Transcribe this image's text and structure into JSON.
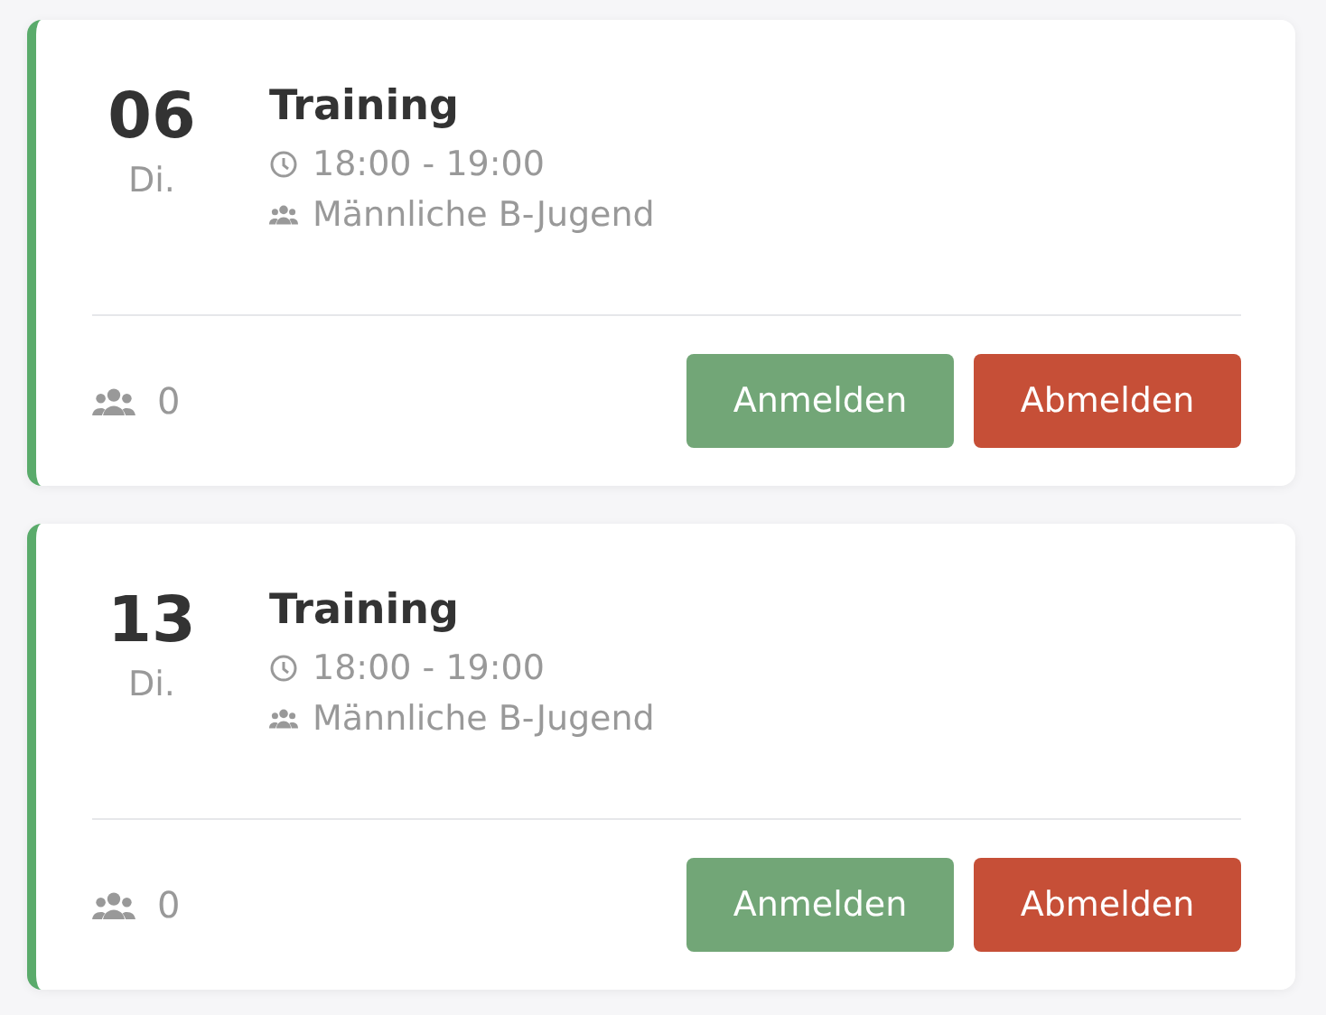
{
  "events": [
    {
      "day": "06",
      "weekday": "Di.",
      "title": "Training",
      "time": "18:00 - 19:00",
      "team": "Männliche B-Jugend",
      "attendees": "0",
      "buttons": [
        {
          "label": "Anmelden",
          "kind": "accept"
        },
        {
          "label": "Abmelden",
          "kind": "decline"
        }
      ]
    },
    {
      "day": "13",
      "weekday": "Di.",
      "title": "Training",
      "time": "18:00 - 19:00",
      "team": "Männliche B-Jugend",
      "attendees": "0",
      "buttons": [
        {
          "label": "Anmelden",
          "kind": "accept"
        },
        {
          "label": "Abmelden",
          "kind": "decline"
        }
      ]
    }
  ]
}
